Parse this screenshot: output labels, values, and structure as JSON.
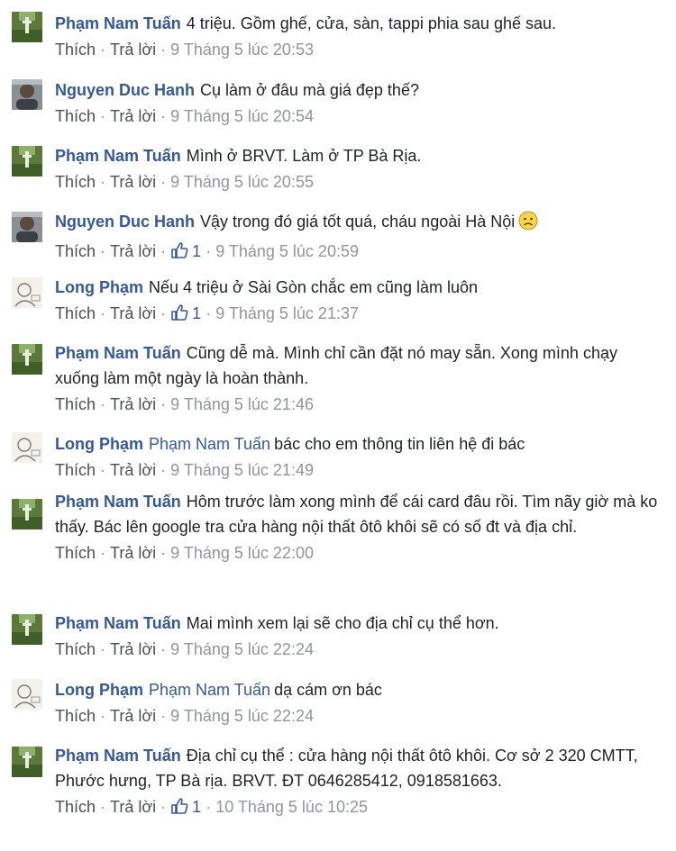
{
  "actions": {
    "like": "Thích",
    "reply": "Trả lời",
    "separator": "·"
  },
  "comments": [
    {
      "author": "Phạm Nam Tuấn",
      "avatar": "field-avatar",
      "tagged": "",
      "text": "4 triệu. Gồm ghế, cửa, sàn, tappi phia sau ghế sau.",
      "likes": "",
      "time": "9 Tháng 5 lúc 20:53"
    },
    {
      "author": "Nguyen Duc Hanh",
      "avatar": "person-avatar",
      "tagged": "",
      "text": "Cụ làm ở đâu mà giá đẹp thế?",
      "likes": "",
      "time": "9 Tháng 5 lúc 20:54"
    },
    {
      "author": "Phạm Nam Tuấn",
      "avatar": "field-avatar",
      "tagged": "",
      "text": "Mình ở BRVT. Làm ở TP Bà Rịa.",
      "likes": "",
      "time": "9 Tháng 5 lúc 20:55"
    },
    {
      "author": "Nguyen Duc Hanh",
      "avatar": "person-avatar",
      "tagged": "",
      "text": "Vậy trong đó giá tốt quá, cháu ngoài Hà Nội",
      "emoji": "frown-emoji",
      "likes": "1",
      "time": "9 Tháng 5 lúc 20:59"
    },
    {
      "author": "Long Phạm",
      "avatar": "sketch-avatar",
      "tagged": "",
      "text": "Nếu 4 triệu ở Sài Gòn chắc em cũng làm luôn",
      "likes": "1",
      "time": "9 Tháng 5 lúc 21:37"
    },
    {
      "author": "Phạm Nam Tuấn",
      "avatar": "field-avatar",
      "tagged": "",
      "text": "Cũng dễ mà. Mình chỉ cần đặt nó may sẵn. Xong mình chạy xuống làm một ngày là hoàn thành.",
      "likes": "",
      "time": "9 Tháng 5 lúc 21:46"
    },
    {
      "author": "Long Phạm",
      "avatar": "sketch-avatar",
      "tagged": "Phạm Nam Tuấn",
      "text": "bác cho em thông tin liên hệ đi bác",
      "likes": "",
      "time": "9 Tháng 5 lúc 21:49"
    },
    {
      "author": "Phạm Nam Tuấn",
      "avatar": "field-avatar",
      "tagged": "",
      "text": "Hôm trước làm xong mình để cái card đâu rồi. Tìm nãy giờ mà ko thấy. Bác lên google tra cửa hàng nội thất ôtô khôi sẽ có số đt và địa chỉ.",
      "likes": "",
      "time": "9 Tháng 5 lúc 22:00"
    },
    {
      "author": "Phạm Nam Tuấn",
      "avatar": "field-avatar",
      "tagged": "",
      "text": "Mai mình xem lại sẽ cho địa chỉ cụ thể hơn.",
      "likes": "",
      "time": "9 Tháng 5 lúc 22:24"
    },
    {
      "author": "Long Phạm",
      "avatar": "sketch-avatar",
      "tagged": "Phạm Nam Tuấn",
      "text": "dạ cám ơn bác",
      "likes": "",
      "time": "9 Tháng 5 lúc 22:24"
    },
    {
      "author": "Phạm Nam Tuấn",
      "avatar": "field-avatar",
      "tagged": "",
      "text": "Địa chỉ cụ thể : cửa hàng nội thất ôtô khôi. Cơ sở 2 320 CMTT, Phước hưng, TP Bà rịa. BRVT. ĐT 0646285412, 0918581663.",
      "likes": "1",
      "time": "10 Tháng 5 lúc 10:25"
    }
  ]
}
